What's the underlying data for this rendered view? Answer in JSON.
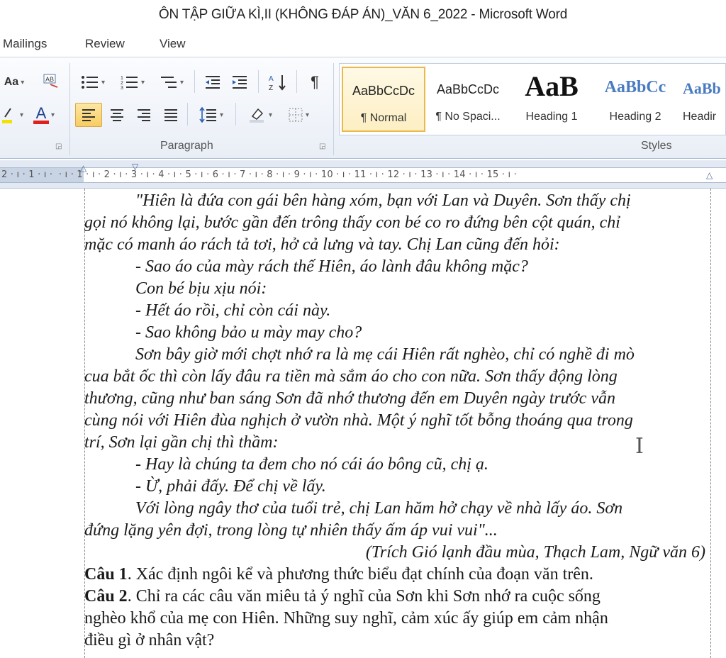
{
  "window": {
    "title": "ÔN TẬP GIỮA KÌ,II (KHÔNG ĐÁP ÁN)_VĂN 6_2022  -  Microsoft Word"
  },
  "ribbon_tabs": [
    {
      "label": "Mailings"
    },
    {
      "label": "Review"
    },
    {
      "label": "View"
    }
  ],
  "ribbon": {
    "font_group": {
      "change_case_label": "Aa",
      "font_color_label": "A",
      "font_color_hex": "#e02020",
      "highlight_color_hex": "#f2e200"
    },
    "paragraph_group": {
      "label": "Paragraph",
      "show_marks_glyph": "¶",
      "sort_label": "A Z"
    },
    "styles_group": {
      "label": "Styles",
      "items": [
        {
          "sample": "AaBbCcDc",
          "name": "¶ Normal",
          "selected": true
        },
        {
          "sample": "AaBbCcDc",
          "name": "¶ No Spaci...",
          "selected": false
        },
        {
          "sample": "AaB",
          "name": "Heading 1",
          "selected": false
        },
        {
          "sample": "AaBbCc",
          "name": "Heading 2",
          "selected": false
        },
        {
          "sample": "AaBb",
          "name": "Headir",
          "selected": false
        }
      ]
    }
  },
  "ruler": {
    "text": "2 · ı · 1 · ı · ⁠   · ı · 1 · ı · 2 · ı · 3 · ı · 4 · ı · 5 · ı · 6 · ı · 7 · ı · 8 · ı · 9 · ı · 10 · ı · 11 · ı · 12 · ı · 13 · ı · 14 · ı · 15 · ı ·"
  },
  "document": {
    "lines": [
      {
        "text": "\"Hiên là đứa con gái bên hàng xóm, bạn với Lan và Duyên. Sơn thấy chị",
        "indent": true
      },
      {
        "text": "gọi nó không lại, bước gần đến trông thấy con bé co ro đứng bên cột quán, chỉ",
        "indent": false
      },
      {
        "text": "mặc có manh áo rách tả tơi, hở cả lưng và tay. Chị Lan cũng đến hỏi:",
        "indent": false
      },
      {
        "text": "- Sao áo của mày rách thế Hiên, áo lành đâu không mặc?",
        "indent": true
      },
      {
        "text": "Con bé bịu xịu nói:",
        "indent": true
      },
      {
        "text": "- Hết áo rồi, chỉ còn cái này.",
        "indent": true
      },
      {
        "text": "- Sao không bảo u mày may cho?",
        "indent": true
      },
      {
        "text": "Sơn bây giờ mới chợt nhớ ra là mẹ cái Hiên rất nghèo, chỉ có nghề đi mò",
        "indent": true
      },
      {
        "text": "cua bắt ốc thì còn lấy đâu ra tiền mà sắm áo cho con nữa. Sơn thấy động lòng",
        "indent": false
      },
      {
        "text": "thương, cũng như ban sáng Sơn đã nhớ thương đến em Duyên ngày trước vẫn",
        "indent": false
      },
      {
        "text": "cùng nói với Hiên đùa nghịch ở vườn nhà. Một ý nghĩ tốt bỗng thoáng qua trong",
        "indent": false
      },
      {
        "text": "trí, Sơn lại gần chị thì thầm:",
        "indent": false
      },
      {
        "text": "- Hay là chúng ta đem cho nó cái áo bông cũ, chị ạ.",
        "indent": true
      },
      {
        "text": "- Ừ, phải đấy. Để chị về lấy.",
        "indent": true
      },
      {
        "text": "Với lòng ngây thơ của tuổi trẻ, chị Lan hăm hở chạy về nhà lấy áo. Sơn",
        "indent": true
      },
      {
        "text": "đứng lặng yên đợi, trong lòng tự nhiên thấy ấm áp vui vui\"...",
        "indent": false
      }
    ],
    "citation": "(Trích Gió lạnh đầu mùa, Thạch Lam, Ngữ văn 6)",
    "questions": [
      {
        "label": "Câu 1",
        "text": ". Xác định ngôi kể và phương thức biểu đạt chính của đoạn văn trên."
      },
      {
        "label": "Câu 2",
        "text": ". Chỉ ra các câu văn miêu tả ý nghĩ của Sơn khi Sơn nhớ ra cuộc sống"
      }
    ],
    "question_continuations": [
      "nghèo khổ của mẹ con Hiên. Những suy nghĩ, cảm xúc ấy giúp em cảm nhận",
      "điều gì ở nhân vật?"
    ]
  }
}
